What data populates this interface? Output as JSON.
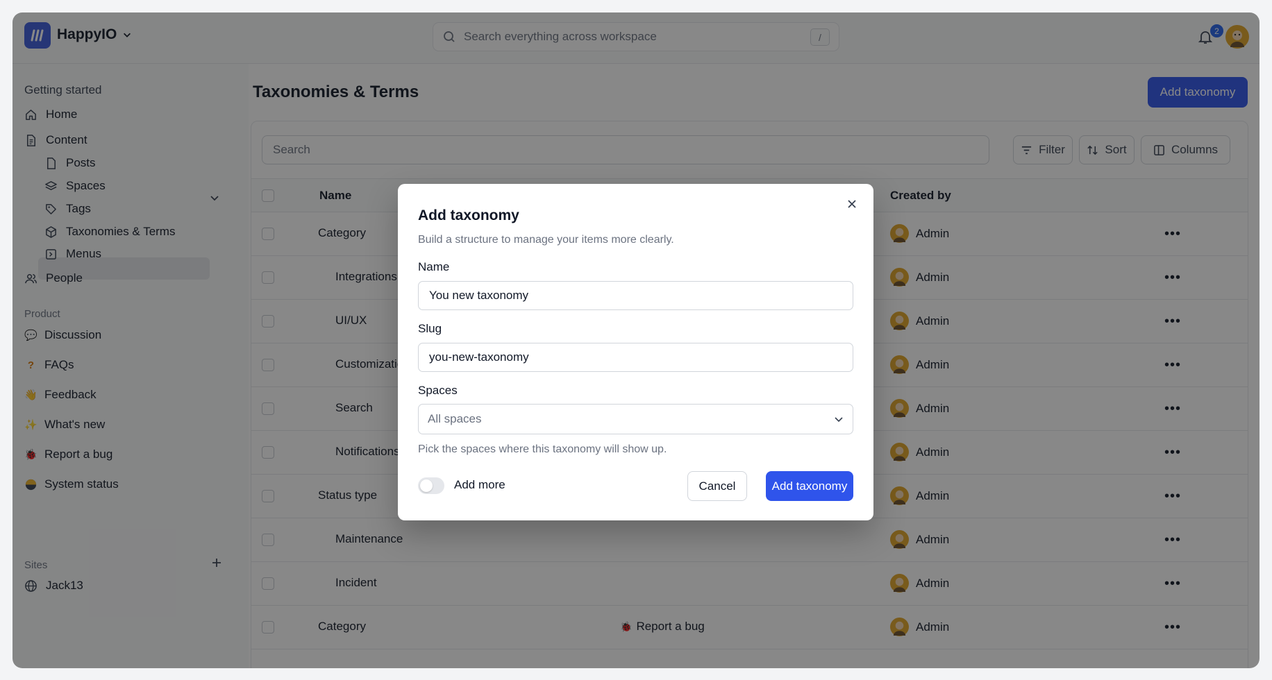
{
  "header": {
    "brand": "HappyIO",
    "search_placeholder": "Search everything across workspace",
    "search_shortcut": "/",
    "notification_count": "2"
  },
  "sidebar": {
    "getting_started": "Getting started",
    "items": {
      "home": "Home",
      "content": "Content",
      "posts": "Posts",
      "spaces": "Spaces",
      "tags": "Tags",
      "taxonomies": "Taxonomies & Terms",
      "menus": "Menus",
      "people": "People"
    },
    "product_section": "Product",
    "product_items": {
      "discussion": "Discussion",
      "faqs": "FAQs",
      "feedback": "Feedback",
      "whats_new": "What's new",
      "report_bug": "Report a bug",
      "system_status": "System status"
    },
    "sites_section": "Sites",
    "site": "Jack13"
  },
  "main": {
    "title": "Taxonomies & Terms",
    "add_button": "Add taxonomy",
    "search_placeholder": "Search",
    "filter": "Filter",
    "sort": "Sort",
    "columns": "Columns",
    "headers": {
      "name": "Name",
      "created_by": "Created by"
    },
    "rows": [
      {
        "name": "Category",
        "space": "",
        "creator": "Admin"
      },
      {
        "name": "Integrations",
        "space": "",
        "creator": "Admin"
      },
      {
        "name": "UI/UX",
        "space": "",
        "creator": "Admin"
      },
      {
        "name": "Customization",
        "space": "",
        "creator": "Admin"
      },
      {
        "name": "Search",
        "space": "",
        "creator": "Admin"
      },
      {
        "name": "Notifications",
        "space": "",
        "creator": "Admin"
      },
      {
        "name": "Status type",
        "space": "",
        "creator": "Admin"
      },
      {
        "name": "Maintenance",
        "space": "",
        "creator": "Admin"
      },
      {
        "name": "Incident",
        "space": "",
        "creator": "Admin"
      },
      {
        "name": "Category",
        "space": "Report a bug",
        "creator": "Admin"
      }
    ]
  },
  "modal": {
    "title": "Add taxonomy",
    "description": "Build a structure to manage your items more clearly.",
    "name_label": "Name",
    "name_value": "You new taxonomy",
    "slug_label": "Slug",
    "slug_value": "you-new-taxonomy",
    "spaces_label": "Spaces",
    "spaces_value": "All spaces",
    "spaces_hint": "Pick the spaces where this taxonomy will show up.",
    "add_more_label": "Add more",
    "cancel": "Cancel",
    "submit": "Add taxonomy"
  },
  "colors": {
    "primary": "#2f54eb",
    "logo": "#3b5bdb"
  }
}
